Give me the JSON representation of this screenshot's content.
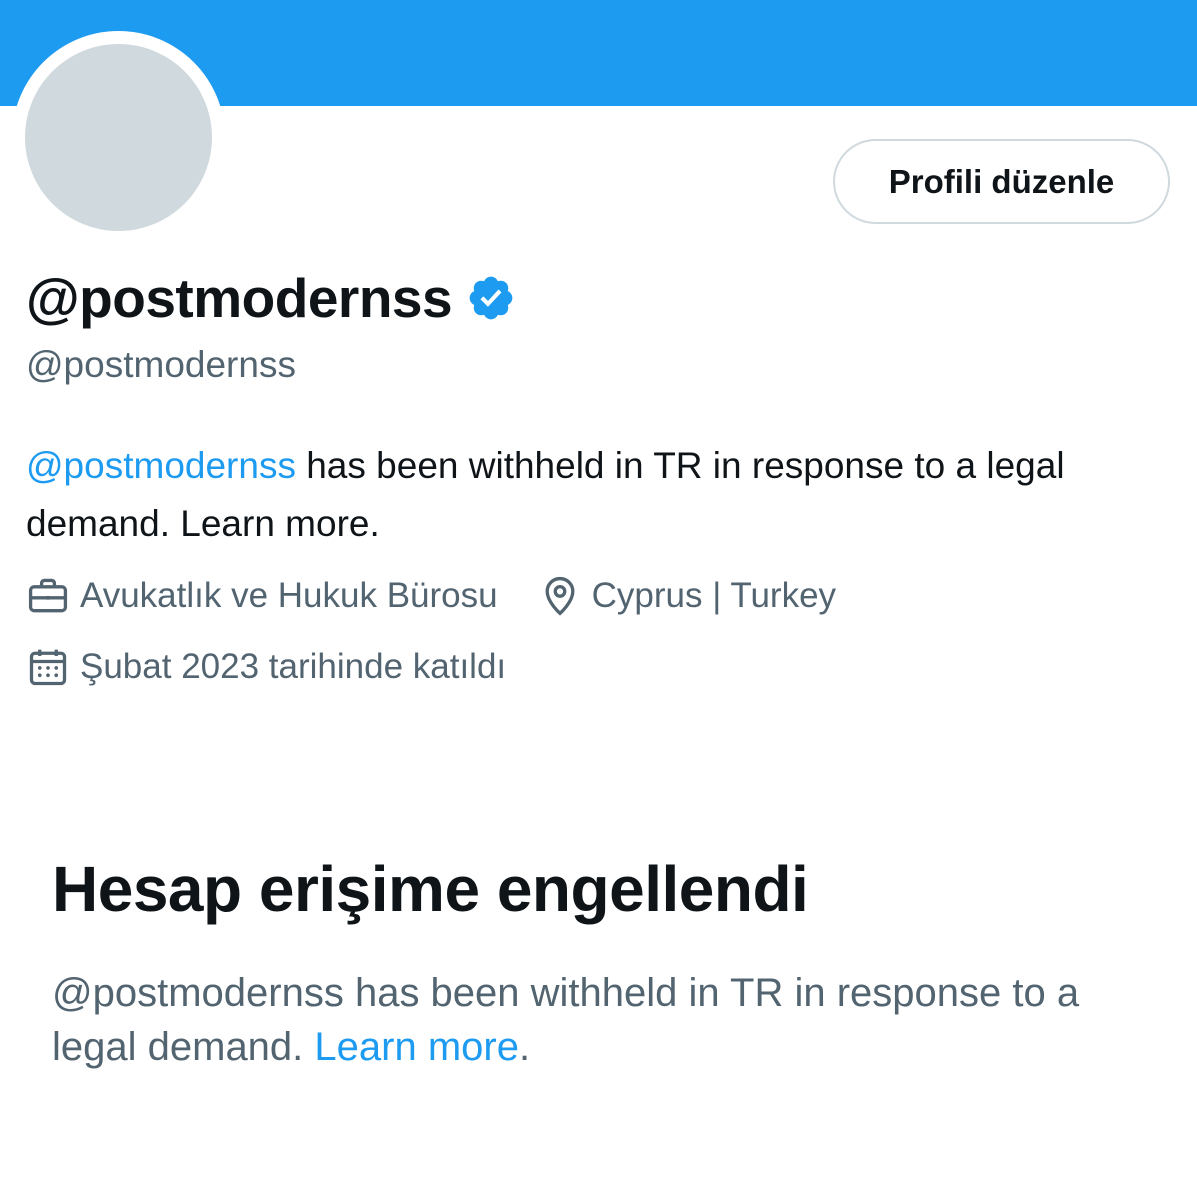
{
  "colors": {
    "accent": "#1d9bf0",
    "text_primary": "#0f1419",
    "text_secondary": "#536471",
    "avatar_placeholder": "#cfd9de"
  },
  "header": {
    "edit_profile_label": "Profili düzenle"
  },
  "profile": {
    "display_name": "@postmodernss",
    "verified_icon": "verified-badge-icon",
    "handle": "@postmodernss",
    "bio": {
      "mention": "@postmodernss",
      "text": " has been withheld in TR in response to a legal demand. Learn more."
    },
    "meta": {
      "profession_icon": "briefcase-icon",
      "profession": "Avukatlık ve Hukuk Bürosu",
      "location_icon": "location-pin-icon",
      "location": "Cyprus | Turkey",
      "joined_icon": "calendar-icon",
      "joined": "Şubat 2023 tarihinde katıldı"
    }
  },
  "withheld_notice": {
    "title": "Hesap erişime engellendi",
    "text": "@postmodernss has been withheld in TR in response to a legal demand. ",
    "learn_more": "Learn more",
    "trailing": "."
  }
}
